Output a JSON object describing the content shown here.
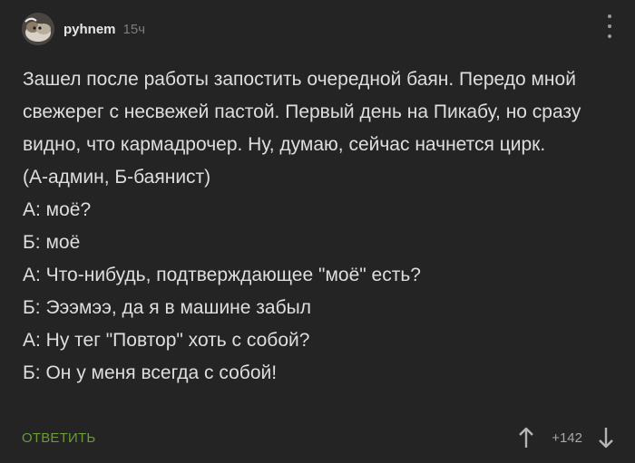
{
  "comment": {
    "author": "pyhnem",
    "time": "15ч",
    "paragraphs": [
      "Зашел после работы запостить очередной баян. Передо мной свежерег с несвежей пастой. Первый день на Пикабу, но сразу видно, что кармадрочер. Ну, думаю, сейчас начнется цирк.",
      "(А-админ, Б-баянист)",
      "А: моё?",
      "Б: моё",
      "А: Что-нибудь, подтверждающее \"моё\" есть?",
      "Б: Эээмээ, да я в машине забыл",
      "А: Ну тег \"Повтор\" хоть с собой?",
      "Б: Он у меня всегда с собой!"
    ],
    "reply_label": "ОТВЕТИТЬ",
    "rating": "+142"
  },
  "icons": {
    "avatar": "avatar-image",
    "menu": "more-vertical-icon",
    "upvote": "arrow-up-icon",
    "downvote": "arrow-down-icon"
  },
  "colors": {
    "background": "#242424",
    "text": "#dedede",
    "muted": "#7c7c7c",
    "reply": "#6b9a3b"
  }
}
